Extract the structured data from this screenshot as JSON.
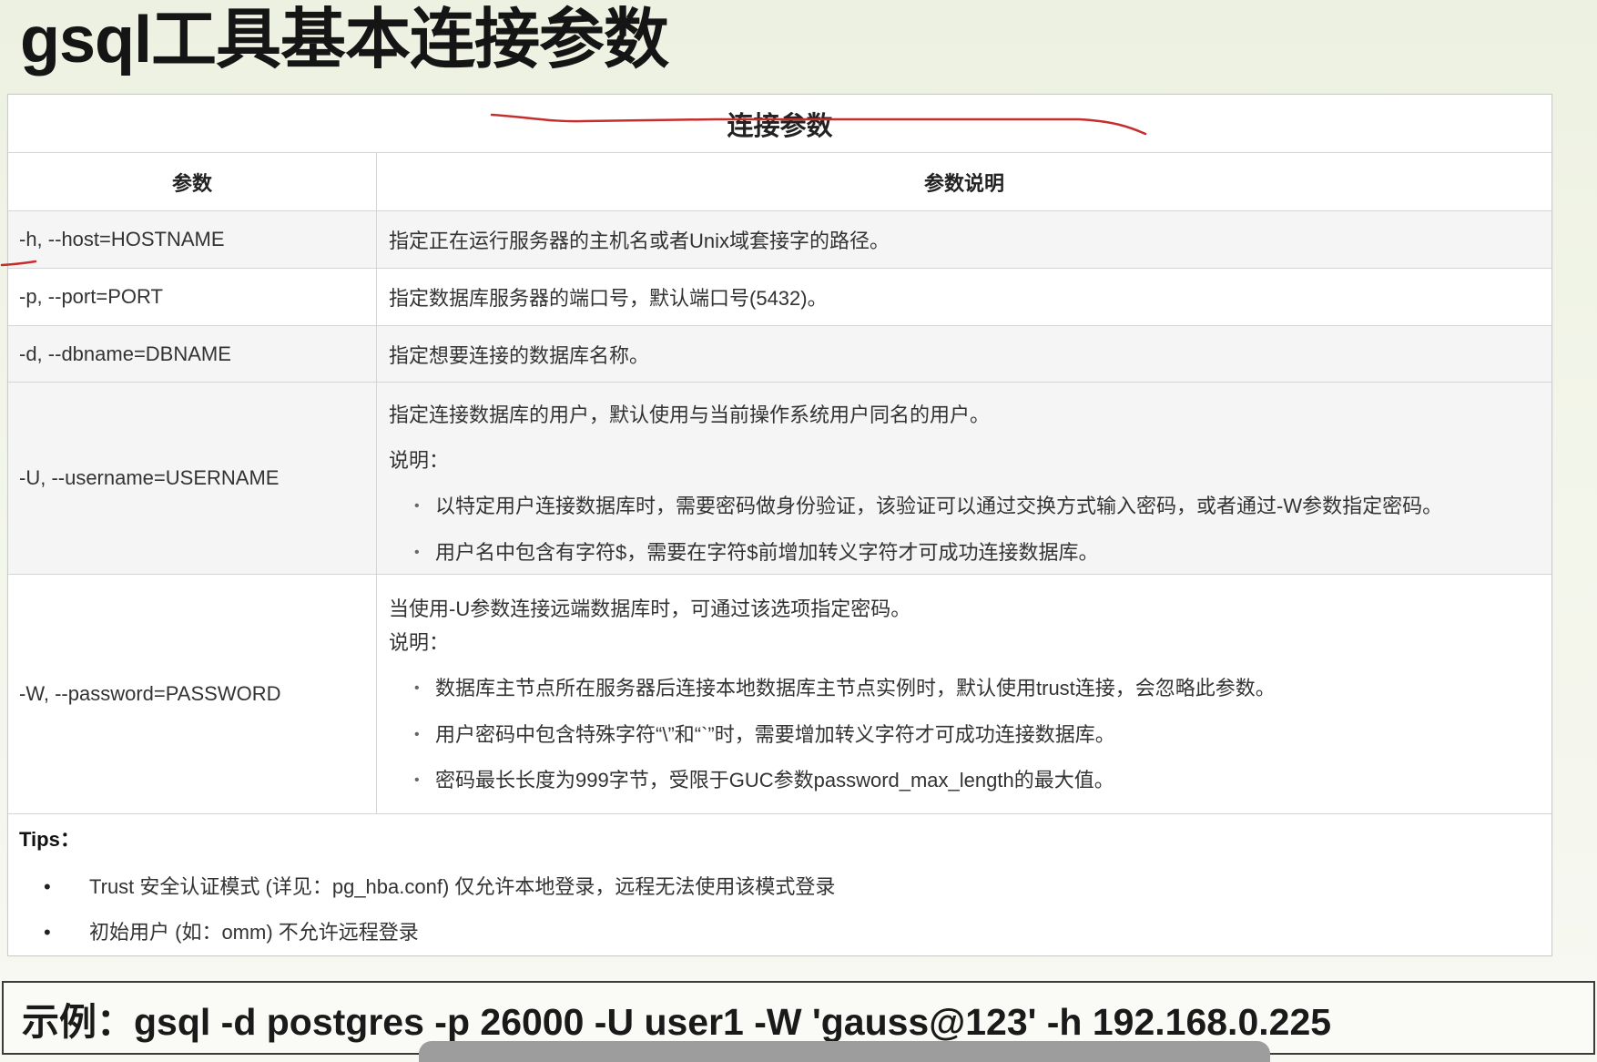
{
  "title": "gsql工具基本连接参数",
  "table": {
    "caption": "连接参数",
    "headers": {
      "param": "参数",
      "desc": "参数说明"
    },
    "rows": [
      {
        "param": "-h, --host=HOSTNAME",
        "desc": "指定正在运行服务器的主机名或者Unix域套接字的路径。"
      },
      {
        "param": "-p, --port=PORT",
        "desc": "指定数据库服务器的端口号，默认端口号(5432)。"
      },
      {
        "param": "-d, --dbname=DBNAME",
        "desc": "指定想要连接的数据库名称。"
      },
      {
        "param": "-U, --username=USERNAME",
        "desc": "指定连接数据库的用户，默认使用与当前操作系统用户同名的用户。",
        "note": "说明：",
        "bullets": [
          "以特定用户连接数据库时，需要密码做身份验证，该验证可以通过交换方式输入密码，或者通过-W参数指定密码。",
          "用户名中包含有字符$，需要在字符$前增加转义字符才可成功连接数据库。"
        ]
      },
      {
        "param": "-W, --password=PASSWORD",
        "desc": "当使用-U参数连接远端数据库时，可通过该选项指定密码。",
        "note": "说明：",
        "bullets": [
          "数据库主节点所在服务器后连接本地数据库主节点实例时，默认使用trust连接，会忽略此参数。",
          "用户密码中包含特殊字符“\\”和“`”时，需要增加转义字符才可成功连接数据库。",
          "密码最长长度为999字节，受限于GUC参数password_max_length的最大值。"
        ]
      }
    ]
  },
  "tips": {
    "label": "Tips：",
    "items": [
      "Trust 安全认证模式 (详见：pg_hba.conf) 仅允许本地登录，远程无法使用该模式登录",
      "初始用户 (如：omm) 不允许远程登录"
    ]
  },
  "example": "示例：gsql -d postgres -p 26000 -U user1 -W 'gauss@123' -h 192.168.0.225",
  "colors": {
    "annotation_ink": "#c62d2d",
    "row_shade": "#f5f5f5"
  }
}
